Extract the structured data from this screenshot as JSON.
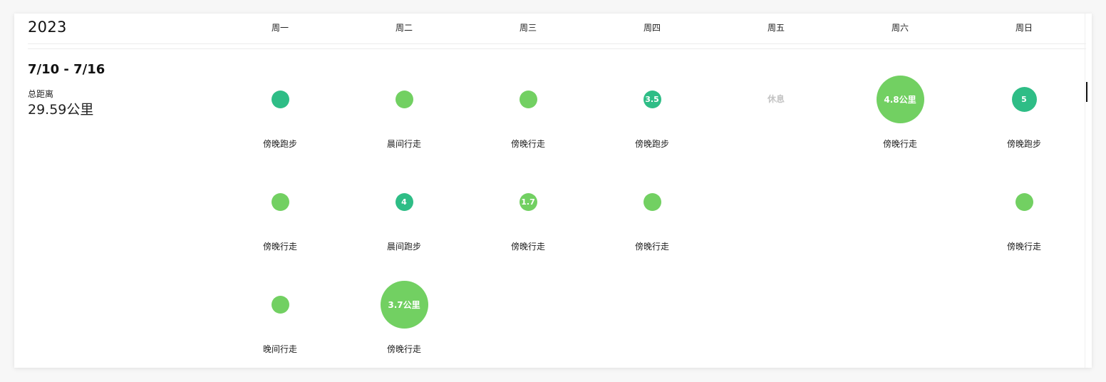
{
  "year": "2023",
  "days": [
    "周一",
    "周二",
    "周三",
    "周四",
    "周五",
    "周六",
    "周日"
  ],
  "week": {
    "range": "7/10 - 7/16",
    "distance_label": "总距离",
    "distance_value": "29.59公里"
  },
  "colors": {
    "run": "#2ebd86",
    "walk": "#72d062",
    "rest": "#c4c4c4"
  },
  "activities": [
    {
      "day": 0,
      "row": 0,
      "kind": "run",
      "size": "small",
      "value": "",
      "label": "傍晚跑步"
    },
    {
      "day": 1,
      "row": 0,
      "kind": "walk",
      "size": "small",
      "value": "",
      "label": "晨间行走"
    },
    {
      "day": 2,
      "row": 0,
      "kind": "walk",
      "size": "small",
      "value": "",
      "label": "傍晚行走"
    },
    {
      "day": 3,
      "row": 0,
      "kind": "run",
      "size": "small",
      "value": "3.5",
      "label": "傍晚跑步"
    },
    {
      "day": 5,
      "row": 0,
      "kind": "walk",
      "size": "large",
      "value": "4.8公里",
      "label": "傍晚行走"
    },
    {
      "day": 6,
      "row": 0,
      "kind": "run",
      "size": "medium",
      "value": "5",
      "label": "傍晚跑步"
    },
    {
      "day": 0,
      "row": 1,
      "kind": "walk",
      "size": "small",
      "value": "",
      "label": "傍晚行走"
    },
    {
      "day": 1,
      "row": 1,
      "kind": "run",
      "size": "small",
      "value": "4",
      "label": "晨间跑步"
    },
    {
      "day": 2,
      "row": 1,
      "kind": "walk",
      "size": "small",
      "value": "1.7",
      "label": "傍晚行走"
    },
    {
      "day": 3,
      "row": 1,
      "kind": "walk",
      "size": "small",
      "value": "",
      "label": "傍晚行走"
    },
    {
      "day": 6,
      "row": 1,
      "kind": "walk",
      "size": "small",
      "value": "",
      "label": "傍晚行走"
    },
    {
      "day": 0,
      "row": 2,
      "kind": "walk",
      "size": "small",
      "value": "",
      "label": "晚间行走"
    },
    {
      "day": 1,
      "row": 2,
      "kind": "walk",
      "size": "large",
      "value": "3.7公里",
      "label": "傍晚行走"
    }
  ],
  "rest_days": [
    {
      "day": 4,
      "row": 0,
      "label": "休息"
    }
  ]
}
